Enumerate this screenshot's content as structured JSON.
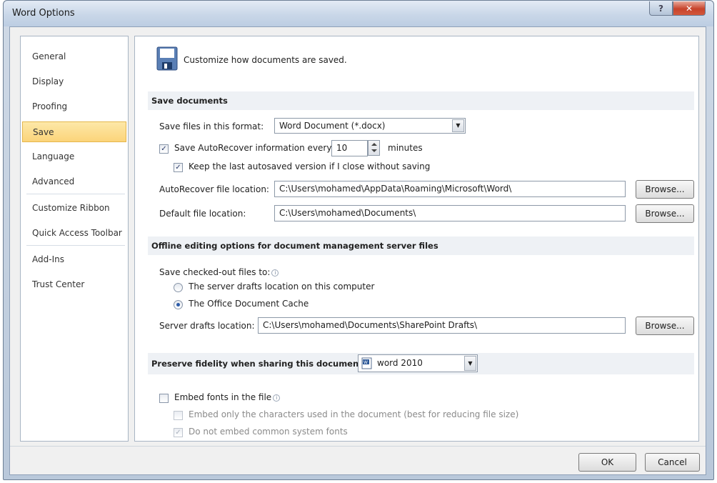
{
  "window": {
    "title": "Word Options"
  },
  "sidebar": {
    "items": [
      {
        "label": "General"
      },
      {
        "label": "Display"
      },
      {
        "label": "Proofing"
      },
      {
        "label": "Save",
        "active": true
      },
      {
        "label": "Language"
      },
      {
        "label": "Advanced"
      },
      {
        "label": "Customize Ribbon"
      },
      {
        "label": "Quick Access Toolbar"
      },
      {
        "label": "Add-Ins"
      },
      {
        "label": "Trust Center"
      }
    ]
  },
  "header": {
    "title": "Customize how documents are saved.",
    "icon": "floppy-disk-icon"
  },
  "save_documents": {
    "section_title": "Save documents",
    "format_label": "Save files in this format:",
    "format_value": "Word Document (*.docx)",
    "autorecover_label": "Save AutoRecover information every",
    "autorecover_checked": true,
    "autorecover_minutes": "10",
    "minutes_label": "minutes",
    "keep_last_label": "Keep the last autosaved version if I close without saving",
    "keep_last_checked": true,
    "autorecover_location_label": "AutoRecover file location:",
    "autorecover_location_value": "C:\\Users\\mohamed\\AppData\\Roaming\\Microsoft\\Word\\",
    "default_location_label": "Default file location:",
    "default_location_value": "C:\\Users\\mohamed\\Documents\\",
    "browse_label": "Browse..."
  },
  "offline": {
    "section_title": "Offline editing options for document management server files",
    "save_checked_out_label": "Save checked-out files to:",
    "option_server_label": "The server drafts location on this computer",
    "option_cache_label": "The Office Document Cache",
    "selected_option": "cache",
    "server_drafts_label": "Server drafts location:",
    "server_drafts_value": "C:\\Users\\mohamed\\Documents\\SharePoint Drafts\\",
    "browse_label": "Browse..."
  },
  "fidelity": {
    "section_title": "Preserve fidelity when sharing this document:",
    "document_value": "word 2010",
    "embed_fonts_label": "Embed fonts in the file",
    "embed_fonts_checked": false,
    "embed_only_label": "Embed only the characters used in the document (best for reducing file size)",
    "embed_only_checked": false,
    "no_common_label": "Do not embed common system fonts",
    "no_common_checked": true
  },
  "footer": {
    "ok_label": "OK",
    "cancel_label": "Cancel"
  },
  "colors": {
    "accent": "#fbd47a",
    "section_bg": "#eef1f5",
    "titlebar": "#c9d7e8",
    "close_red": "#c7432b"
  }
}
